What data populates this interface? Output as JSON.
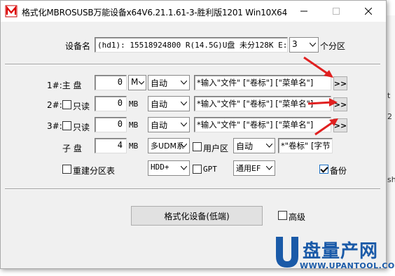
{
  "window": {
    "title": "格式化MBROSUSB万能设备x64V6.21.1.61-3-胜利版1201 Win10X64",
    "min_label": "—",
    "max_label": "☐",
    "close_label": "✕"
  },
  "device": {
    "label": "设备名",
    "value": "(hd1): 15518924800 R(14.5G)U盘 未分128K E: [N",
    "partitions_count": "3",
    "partitions_suffix": "个分区"
  },
  "rows": [
    {
      "label": "1#:主   盘",
      "size": "0",
      "unit_combo": "M",
      "fs": "自动",
      "volume": "*输入\"文件\" [\"卷标\"] [\"菜单名\"]",
      "browse": ">>"
    },
    {
      "label": "2#:",
      "readonly_label": "只读",
      "size": "0",
      "unit": "MB",
      "fs": "自动",
      "volume": "*输入\"文件\" [\"卷标\"] [\"菜单名\"]",
      "browse": ">>"
    },
    {
      "label": "3#:",
      "readonly_label": "只读",
      "size": "0",
      "unit": "MB",
      "fs": "自动",
      "volume": "*输入\"文件\" [\"卷标\"] [\"菜单名\"]",
      "browse": ">>"
    }
  ],
  "subdisk": {
    "label": "子   盘",
    "size": "4",
    "unit": "MB",
    "mode": "多UDM系",
    "userarea_label": "用户区",
    "fs": "自动",
    "volume": "*\"卷标\" [字节"
  },
  "options": {
    "rebuild_label": "重建分区表",
    "hdd_mode": "HDD+",
    "gpt_label": "GPT",
    "efi_mode": "通用EF",
    "backup_label": "备份",
    "backup_checked": true
  },
  "actions": {
    "format_label": "格式化设备(低端)",
    "advanced_label": "高级"
  },
  "watermark": {
    "brand": "盘量产网",
    "url": "WWW.UPANTOOL.COM"
  },
  "backdrop": {
    "frag1": "V6",
    "frag2": "2",
    "frag3": "自",
    "frag4": "自",
    "frag5": "自",
    "frag6": "多",
    "frag7": "H",
    "frag8": "t",
    "frag9": "2",
    "frag10": "sh"
  }
}
